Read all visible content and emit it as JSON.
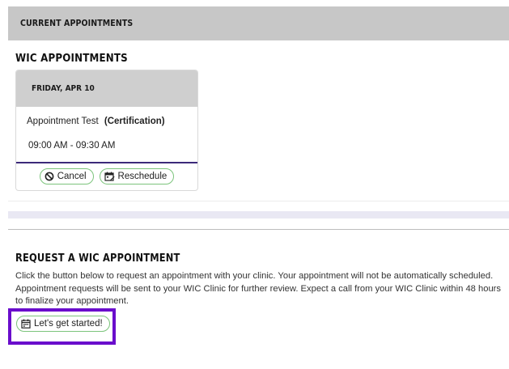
{
  "current_header": "CURRENT APPOINTMENTS",
  "wic_section_title": "WIC APPOINTMENTS",
  "appointment": {
    "date": "FRIDAY, APR 10",
    "name": "Appointment Test",
    "type": "(Certification)",
    "time": "09:00 AM - 09:30 AM",
    "cancel_label": "Cancel",
    "cancel_icon": "cancel-circle-icon",
    "reschedule_label": "Reschedule",
    "reschedule_icon": "calendar-edit-icon"
  },
  "request": {
    "title": "REQUEST A WIC APPOINTMENT",
    "description": "Click the button below to request an appointment with your clinic. Your appointment will not be automatically scheduled. Appointment requests will be sent to your WIC Clinic for further review. Expect a call from your WIC Clinic within 48 hours to finalize your appointment.",
    "button_label": "Let's get started!",
    "button_icon": "calendar-icon"
  },
  "colors": {
    "header_bg": "#c7c7c7",
    "card_head_bg": "#cfcfcf",
    "button_border": "#7cc47c",
    "focus_frame": "#6a0dcc",
    "card_divider": "#3c2a7a"
  }
}
